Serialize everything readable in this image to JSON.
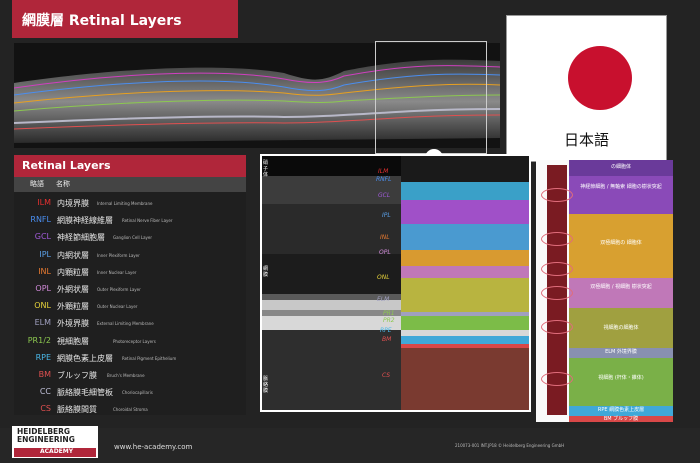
{
  "header": {
    "title": "網膜層 Retinal Layers"
  },
  "flag_card": {
    "label": "日本語",
    "flag_color": "#c8102e"
  },
  "legend": {
    "title": "Retinal Layers",
    "col_abbr": "略語",
    "col_name": "名称",
    "rows": [
      {
        "abbr": "ILM",
        "jp": "内境界膜",
        "en": "Internal Limiting Membrane",
        "color": "#e63030"
      },
      {
        "abbr": "RNFL",
        "jp": "網膜神経線維層",
        "en": "Retinal Nerve Fiber Layer",
        "color": "#4a8ef0"
      },
      {
        "abbr": "GCL",
        "jp": "神経節細胞層",
        "en": "Ganglion Cell Layer",
        "color": "#a05ad8"
      },
      {
        "abbr": "IPL",
        "jp": "内網状層",
        "en": "Inner Plexiform Layer",
        "color": "#5aa0e8"
      },
      {
        "abbr": "INL",
        "jp": "内顆粒層",
        "en": "Inner Nuclear Layer",
        "color": "#e87a30"
      },
      {
        "abbr": "OPL",
        "jp": "外網状層",
        "en": "Outer Plexiform Layer",
        "color": "#d08ad8"
      },
      {
        "abbr": "ONL",
        "jp": "外顆粒層",
        "en": "Outer Nuclear Layer",
        "color": "#e6d23a"
      },
      {
        "abbr": "ELM",
        "jp": "外境界膜",
        "en": "External Limiting Membrane",
        "color": "#a0a0c0"
      },
      {
        "abbr": "PR1/2",
        "jp": "視細胞層",
        "en": "Photoreceptor Layers",
        "color": "#8cc850"
      },
      {
        "abbr": "RPE",
        "jp": "網膜色素上皮層",
        "en": "Retinal Pigment Epithelium",
        "color": "#4ab8e8"
      },
      {
        "abbr": "BM",
        "jp": "ブルッフ膜",
        "en": "Bruch's Membrane",
        "color": "#e05050"
      },
      {
        "abbr": "CC",
        "jp": "脈絡膜毛細管板",
        "en": "Choriocapillaris",
        "color": "#c0c0d8"
      },
      {
        "abbr": "CS",
        "jp": "脈絡膜間質",
        "en": "Choroidal Stroma",
        "color": "#e05050"
      }
    ]
  },
  "mid_panel": {
    "band_labels": [
      "ILM",
      "RNFL",
      "GCL",
      "IPL",
      "INL",
      "OPL",
      "ONL",
      "ELM",
      "PR1",
      "PR2",
      "RPE",
      "BM",
      "CS"
    ],
    "side_labels": [
      "硝子体",
      "網膜",
      "脈絡膜"
    ]
  },
  "right_panel": {
    "labels": [
      "の細胞体",
      "神経節細胞 / 無軸索 細胞の樹状突起",
      "双極細胞の 細胞体",
      "双極細胞 / 視細胞 樹状突起",
      "視細胞の細胞体",
      "ELM 外境界膜",
      "視細胞 (杆体・錐体)",
      "RPE 網膜色素上皮層",
      "BM ブルッフ膜"
    ]
  },
  "footer": {
    "logo_line1": "HEIDELBERG",
    "logo_line2": "ENGINEERING",
    "academy": "ACADEMY",
    "url": "www.he-academy.com",
    "code": "210073-001 INT.JP18 © Heidelberg Engineering GmbH"
  }
}
